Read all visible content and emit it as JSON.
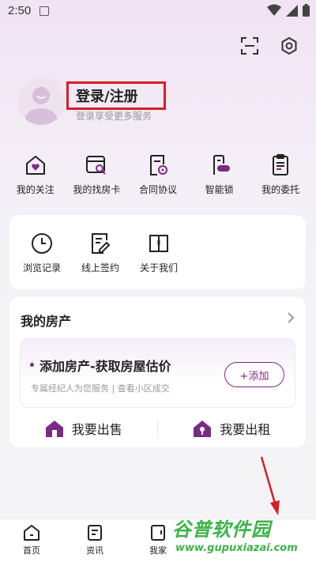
{
  "status_bar": {
    "time": "2:50"
  },
  "profile": {
    "title": "登录/注册",
    "subtitle": "登录享受更多服务"
  },
  "quick_actions": [
    {
      "label": "我的关注",
      "icon": "house-heart-icon"
    },
    {
      "label": "我的找房卡",
      "icon": "search-card-icon"
    },
    {
      "label": "合同协议",
      "icon": "contract-icon"
    },
    {
      "label": "智能锁",
      "icon": "smart-lock-icon"
    },
    {
      "label": "我的委托",
      "icon": "entrust-icon"
    }
  ],
  "tools": [
    {
      "label": "浏览记录",
      "icon": "clock-icon"
    },
    {
      "label": "线上签约",
      "icon": "sign-icon"
    },
    {
      "label": "关于我们",
      "icon": "book-icon"
    }
  ],
  "property": {
    "title": "我的房产",
    "add_title": "添加房产-获取房屋估价",
    "add_subtitle": "专属经纪人为您服务 | 查看小区成交",
    "add_button": "+添加",
    "sell": "我要出售",
    "rent": "我要出租"
  },
  "bottom_nav": [
    {
      "label": "首页",
      "icon": "home-icon"
    },
    {
      "label": "资讯",
      "icon": "news-icon"
    },
    {
      "label": "我家",
      "icon": "myhome-icon"
    }
  ],
  "watermark": {
    "text": "谷普软件园",
    "url": "www.gupuxiazai.com"
  },
  "colors": {
    "accent": "#7a2b83",
    "highlight": "#d81e26",
    "watermark": "#3cb34a"
  }
}
